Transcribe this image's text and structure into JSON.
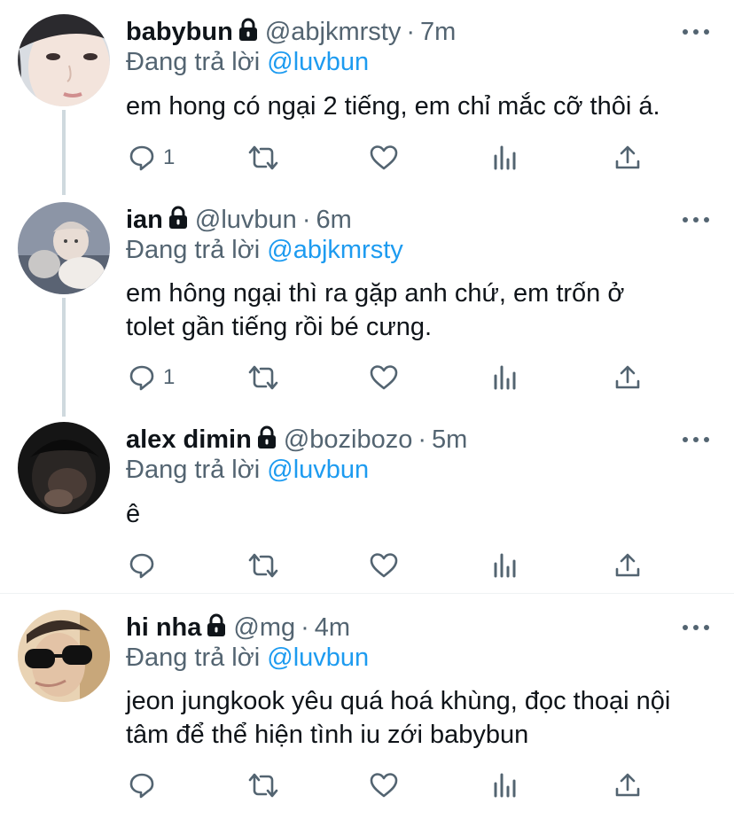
{
  "colors": {
    "text": "#0f1419",
    "muted": "#536471",
    "link": "#1d9bf0",
    "thread_line": "#cfd9de",
    "divider": "#eff3f4"
  },
  "reply_prefix": "Đang trả lời",
  "tweets": [
    {
      "name": "babybun",
      "handle": "@abjkmrsty",
      "time": "7m",
      "reply_to": "@luvbun",
      "text": "em hong có ngại 2 tiếng, em chỉ mắc cỡ thôi á.",
      "reply_count": "1",
      "icons": [
        "lock-icon",
        "more-icon",
        "reply-icon",
        "retweet-icon",
        "like-icon",
        "analytics-icon",
        "share-icon"
      ]
    },
    {
      "name": "ian",
      "handle": "@luvbun",
      "time": "6m",
      "reply_to": "@abjkmrsty",
      "text_lines": [
        "em hông ngại thì ra gặp anh chứ, em trốn ở",
        "tolet gần tiếng rồi bé cưng."
      ],
      "reply_count": "1"
    },
    {
      "name": "alex dimin",
      "handle": "@bozibozo",
      "time": "5m",
      "reply_to": "@luvbun",
      "text": "ê",
      "reply_count": ""
    },
    {
      "name": "hi nha",
      "handle": "@mg",
      "time": "4m",
      "reply_to": "@luvbun",
      "text_lines": [
        "jeon jungkook yêu quá hoá khùng, đọc thoại nội",
        "tâm để thể hiện tình iu zới babybun"
      ],
      "reply_count": ""
    }
  ],
  "separator": "·"
}
